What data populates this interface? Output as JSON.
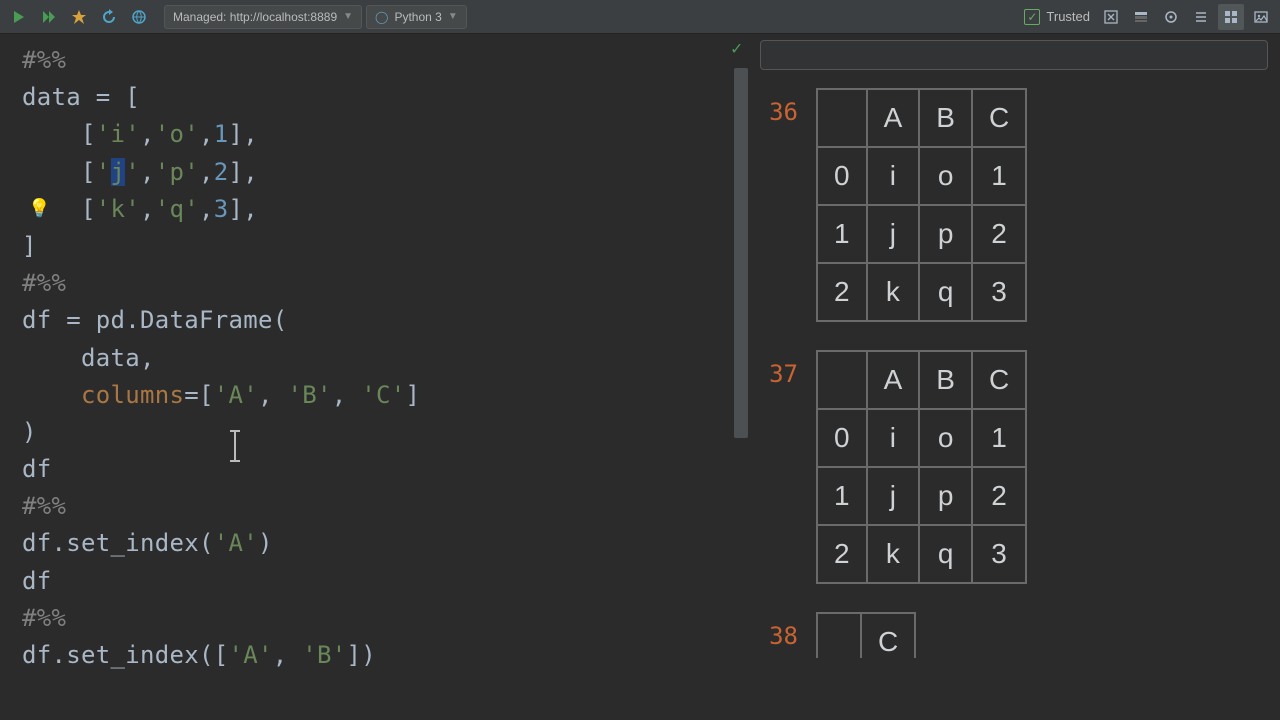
{
  "toolbar": {
    "managed_label": "Managed: http://localhost:8889",
    "kernel_label": "Python 3",
    "trusted_label": "Trusted"
  },
  "icons": {
    "bulb": "💡",
    "check": "✓"
  },
  "code_lines": [
    {
      "segs": [
        {
          "t": "#%%",
          "c": "comment"
        }
      ]
    },
    {
      "segs": [
        {
          "t": "data = [",
          "c": "ident"
        }
      ]
    },
    {
      "segs": [
        {
          "t": "    [",
          "c": "ident"
        },
        {
          "t": "'i'",
          "c": "str"
        },
        {
          "t": ",",
          "c": "ident"
        },
        {
          "t": "'o'",
          "c": "str"
        },
        {
          "t": ",",
          "c": "ident"
        },
        {
          "t": "1",
          "c": "num"
        },
        {
          "t": "],",
          "c": "ident"
        }
      ]
    },
    {
      "segs": [
        {
          "t": "    [",
          "c": "ident"
        },
        {
          "t": "'",
          "c": "str"
        },
        {
          "t": "j",
          "c": "str highlight"
        },
        {
          "t": "'",
          "c": "str"
        },
        {
          "t": ",",
          "c": "ident"
        },
        {
          "t": "'p'",
          "c": "str"
        },
        {
          "t": ",",
          "c": "ident"
        },
        {
          "t": "2",
          "c": "num"
        },
        {
          "t": "],",
          "c": "ident"
        }
      ]
    },
    {
      "segs": [
        {
          "t": "    [",
          "c": "ident"
        },
        {
          "t": "'k'",
          "c": "str"
        },
        {
          "t": ",",
          "c": "ident"
        },
        {
          "t": "'q'",
          "c": "str"
        },
        {
          "t": ",",
          "c": "ident"
        },
        {
          "t": "3",
          "c": "num"
        },
        {
          "t": "],",
          "c": "ident"
        }
      ]
    },
    {
      "segs": [
        {
          "t": "]",
          "c": "ident"
        }
      ]
    },
    {
      "segs": [
        {
          "t": "#%%",
          "c": "comment"
        }
      ]
    },
    {
      "segs": [
        {
          "t": "df = pd.DataFrame(",
          "c": "ident"
        }
      ]
    },
    {
      "segs": [
        {
          "t": "    data,",
          "c": "ident"
        }
      ]
    },
    {
      "segs": [
        {
          "t": "    ",
          "c": "ident"
        },
        {
          "t": "columns",
          "c": "param"
        },
        {
          "t": "=[",
          "c": "ident"
        },
        {
          "t": "'A'",
          "c": "str"
        },
        {
          "t": ", ",
          "c": "ident"
        },
        {
          "t": "'B'",
          "c": "str"
        },
        {
          "t": ", ",
          "c": "ident"
        },
        {
          "t": "'C'",
          "c": "str"
        },
        {
          "t": "]",
          "c": "ident"
        }
      ]
    },
    {
      "segs": [
        {
          "t": ")",
          "c": "ident"
        }
      ]
    },
    {
      "segs": [
        {
          "t": "df",
          "c": "ident"
        }
      ]
    },
    {
      "segs": [
        {
          "t": "#%%",
          "c": "comment"
        }
      ]
    },
    {
      "segs": [
        {
          "t": "df.set_index(",
          "c": "ident"
        },
        {
          "t": "'A'",
          "c": "str"
        },
        {
          "t": ")",
          "c": "ident"
        }
      ]
    },
    {
      "segs": [
        {
          "t": "df",
          "c": "ident"
        }
      ]
    },
    {
      "segs": [
        {
          "t": "#%%",
          "c": "comment"
        }
      ]
    },
    {
      "segs": [
        {
          "t": "df.set_index([",
          "c": "ident"
        },
        {
          "t": "'A'",
          "c": "str"
        },
        {
          "t": ", ",
          "c": "ident"
        },
        {
          "t": "'B'",
          "c": "str"
        },
        {
          "t": "])",
          "c": "ident"
        }
      ]
    }
  ],
  "outputs": [
    {
      "idx": "36",
      "headers": [
        "",
        "A",
        "B",
        "C"
      ],
      "rows": [
        [
          "0",
          "i",
          "o",
          "1"
        ],
        [
          "1",
          "j",
          "p",
          "2"
        ],
        [
          "2",
          "k",
          "q",
          "3"
        ]
      ]
    },
    {
      "idx": "37",
      "headers": [
        "",
        "A",
        "B",
        "C"
      ],
      "rows": [
        [
          "0",
          "i",
          "o",
          "1"
        ],
        [
          "1",
          "j",
          "p",
          "2"
        ],
        [
          "2",
          "k",
          "q",
          "3"
        ]
      ]
    },
    {
      "idx": "38",
      "headers": [
        "",
        "C"
      ],
      "rows": []
    }
  ]
}
